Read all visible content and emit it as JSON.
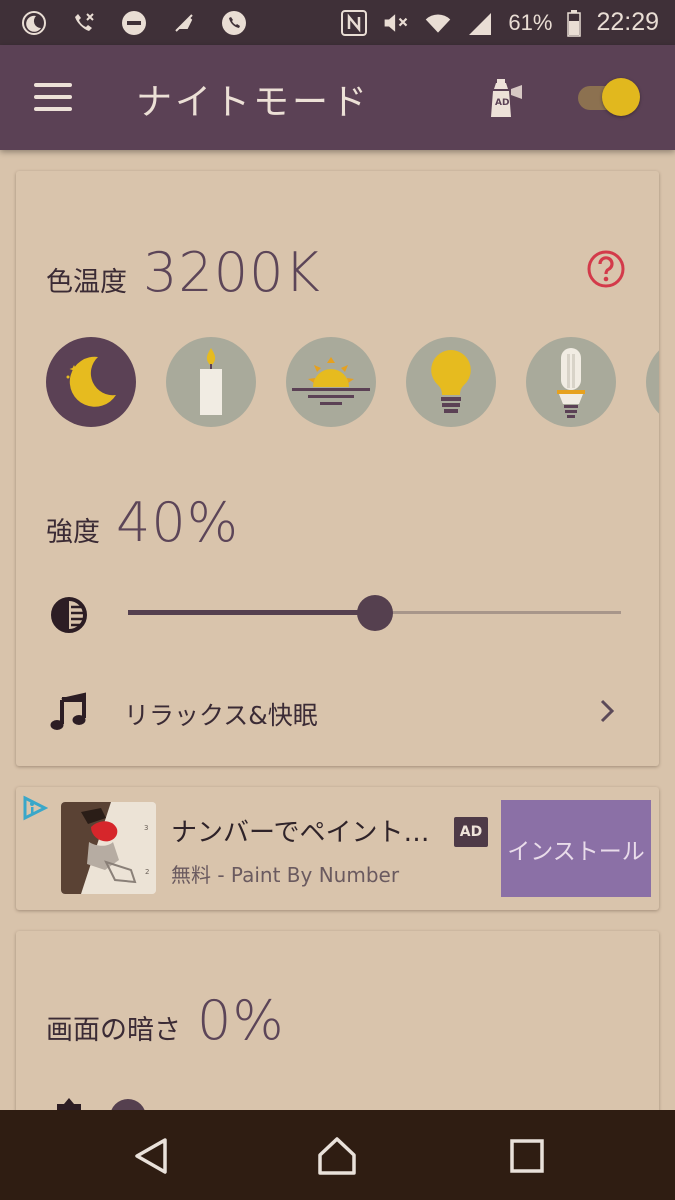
{
  "status_bar": {
    "battery_percent": "61%",
    "time": "22:29",
    "left_icons": [
      "night-mode-icon",
      "missed-call-icon",
      "do-not-disturb-icon",
      "bell-off-icon",
      "phone-icon"
    ],
    "right_icons": [
      "nfc-icon",
      "mute-icon",
      "wifi-icon",
      "signal-icon",
      "battery-icon"
    ]
  },
  "app_bar": {
    "title": "ナイトモード",
    "toggle_on": true,
    "colors": {
      "bar": "#5b4155",
      "toggle_thumb": "#e1b81e"
    }
  },
  "color_temperature": {
    "label": "色温度",
    "value": "3200K",
    "presets": [
      {
        "name": "moon",
        "selected": true
      },
      {
        "name": "candle",
        "selected": false
      },
      {
        "name": "sunset",
        "selected": false
      },
      {
        "name": "light-bulb",
        "selected": false
      },
      {
        "name": "fluorescent-bulb",
        "selected": false
      }
    ]
  },
  "intensity": {
    "label": "強度",
    "value": "40%",
    "slider_level": 0.5
  },
  "relax": {
    "label": "リラックス&快眠"
  },
  "ad": {
    "title": "ナンバーでペイント…",
    "subtitle": "無料 - Paint By Number",
    "badge": "AD",
    "install_label": "インストール",
    "button_color": "#8b70a6"
  },
  "screen_dim": {
    "label": "画面の暗さ",
    "value": "0%"
  }
}
